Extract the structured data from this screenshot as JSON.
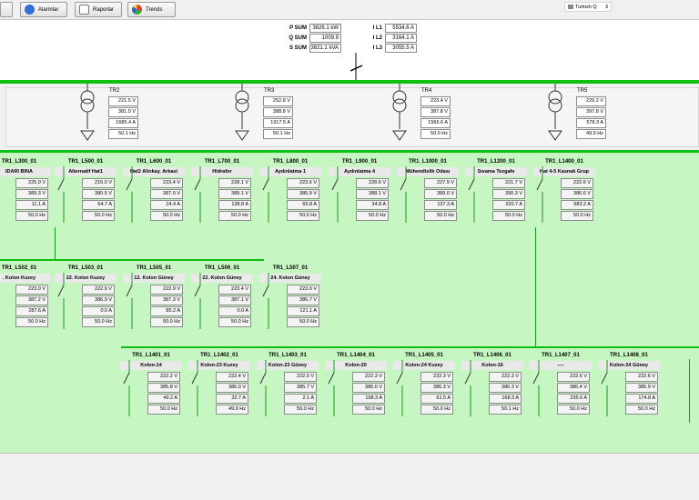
{
  "toolbar": {
    "alarms_label": "Alarmlar",
    "reports_label": "Raporlar",
    "trends_label": "Trends",
    "language_value": "Turkish Q"
  },
  "summary": {
    "p_sum_label": "P SUM",
    "p_sum": "3826.1 kW",
    "q_sum_label": "Q SUM",
    "q_sum": "1009.9",
    "s_sum_label": "S SUM",
    "s_sum": "3821.1 kVA",
    "il1_label": "I L1",
    "il1": "5534.6 A",
    "il2_label": "I L2",
    "il2": "3164.1 A",
    "il3_label": "I L3",
    "il3": "3055.5 A"
  },
  "transformers": [
    {
      "name": "TR2",
      "values": [
        "221.5 V",
        "381.0 V",
        "1685.4 A",
        "50.1 Hz"
      ]
    },
    {
      "name": "TR3",
      "values": [
        "252.8 V",
        "388.8 V",
        "1917.5 A",
        "50.1 Hz"
      ]
    },
    {
      "name": "TR4",
      "values": [
        "223.4 V",
        "387.8 V",
        "1566.6 A",
        "50.0 Hz"
      ]
    },
    {
      "name": "TR5",
      "values": [
        "229.2 V",
        "397.8 V",
        "578.3 A",
        "49.9 Hz"
      ]
    }
  ],
  "row1": [
    {
      "id": "TR1_L300_01",
      "name": "IDARI BINA",
      "values": [
        "225.0 V",
        "389.3 V",
        "11.1 A",
        "50.0 Hz"
      ]
    },
    {
      "id": "TR1_L500_01",
      "name": "Alternatif Hat1",
      "values": [
        "215.0 V",
        "380.5 V",
        "64.7 A",
        "50.0 Hz"
      ]
    },
    {
      "id": "TR1_L600_01",
      "name": "Hat2 Alinkay. Arkasi",
      "values": [
        "223.4 V",
        "387.0 V",
        "24.4 A",
        "50.0 Hz"
      ]
    },
    {
      "id": "TR1_L700_01",
      "name": "Hidrafor",
      "values": [
        "228.1 V",
        "389.1 V",
        "138.8 A",
        "50.0 Hz"
      ]
    },
    {
      "id": "TR1_L800_01",
      "name": "Aydınlatma 1",
      "values": [
        "223.6 V",
        "385.9 V",
        "65.8 A",
        "50.0 Hz"
      ]
    },
    {
      "id": "TR1_L900_01",
      "name": "Aydınlatma 4",
      "values": [
        "228.6 V",
        "388.1 V",
        "34.8 A",
        "50.0 Hz"
      ]
    },
    {
      "id": "TR1_L1000_01",
      "name": "Mühendislik Odası",
      "values": [
        "227.9 V",
        "389.0 V",
        "137.3 A",
        "50.0 Hz"
      ]
    },
    {
      "id": "TR1_L1200_01",
      "name": "Sıvama Tezgahı",
      "values": [
        "221.7 V",
        "390.3 V",
        "220.7 A",
        "50.0 Hz"
      ]
    },
    {
      "id": "TR1_L1400_01",
      "name": "Hat 4-5 Kasnak Grup",
      "values": [
        "222.6 V",
        "386.6 V",
        "683.2 A",
        "50.0 Hz"
      ]
    }
  ],
  "row2": [
    {
      "id": "TR1_L502_01",
      "name": ". Kolon Kuzey",
      "values": [
        "223.0 V",
        "387.2 V",
        "287.6 A",
        "50.0 Hz"
      ]
    },
    {
      "id": "TR1_L503_01",
      "name": "22. Kolon Kuzey",
      "values": [
        "222.9 V",
        "386.9 V",
        "0.0 A",
        "50.0 Hz"
      ]
    },
    {
      "id": "TR1_L505_01",
      "name": "12. Kolon Güney",
      "values": [
        "222.9 V",
        "387.3 V",
        "85.2 A",
        "50.0 Hz"
      ]
    },
    {
      "id": "TR1_L506_01",
      "name": "22. Kolon Güney",
      "values": [
        "223.4 V",
        "387.1 V",
        "0.0 A",
        "50.0 Hz"
      ]
    },
    {
      "id": "TR1_L507_01",
      "name": "24. Kolon Güney",
      "values": [
        "223.0 V",
        "386.7 V",
        "121.1 A",
        "50.0 Hz"
      ]
    }
  ],
  "row3": [
    {
      "id": "TR1_L1401_01",
      "name": "Kolon-14",
      "values": [
        "222.2 V",
        "385.8 V",
        "49.2 A",
        "50.0 Hz"
      ]
    },
    {
      "id": "TR1_L1402_01",
      "name": "Kolon-23 Kuzey",
      "values": [
        "222.4 V",
        "386.0 V",
        "32.7 A",
        "49.9 Hz"
      ]
    },
    {
      "id": "TR1_L1403_01",
      "name": "Kolon-23 Güney",
      "values": [
        "222.0 V",
        "385.7 V",
        "2.1 A",
        "50.0 Hz"
      ]
    },
    {
      "id": "TR1_L1404_01",
      "name": "Kolon-20",
      "values": [
        "222.3 V",
        "386.0 V",
        "198.3 A",
        "50.0 Hz"
      ]
    },
    {
      "id": "TR1_L1405_01",
      "name": "Kolon-24 Kuzey",
      "values": [
        "222.3 V",
        "386.3 V",
        "61.5 A",
        "50.0 Hz"
      ]
    },
    {
      "id": "TR1_L1406_01",
      "name": "Kolon-16",
      "values": [
        "222.3 V",
        "386.3 V",
        "168.3 A",
        "50.1 Hz"
      ]
    },
    {
      "id": "TR1_L1407_01",
      "name": "----",
      "values": [
        "222.6 V",
        "386.4 V",
        "235.6 A",
        "50.0 Hz"
      ]
    },
    {
      "id": "TR1_L1408_01",
      "name": "Kolon-24 Güney",
      "values": [
        "222.6 V",
        "385.9 V",
        "174.8 A",
        "50.0 Hz"
      ]
    }
  ]
}
